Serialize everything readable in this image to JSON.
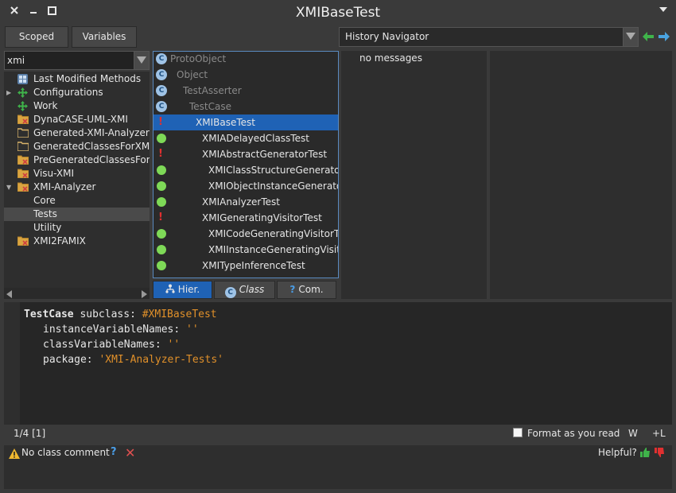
{
  "window": {
    "title": "XMIBaseTest"
  },
  "top_buttons": {
    "scoped": "Scoped",
    "variables": "Variables"
  },
  "filter": {
    "value": "xmi"
  },
  "packages": [
    {
      "label": "Last Modified Methods",
      "icon": "grid-icon",
      "expander": ""
    },
    {
      "label": "Configurations",
      "icon": "configuration-icon",
      "expander": "▶"
    },
    {
      "label": "Work",
      "icon": "configuration-icon",
      "expander": ""
    },
    {
      "label": "DynaCASE-UML-XMI",
      "icon": "package-icon",
      "expander": ""
    },
    {
      "label": "Generated-XMI-Analyzer",
      "icon": "folder-icon",
      "expander": ""
    },
    {
      "label": "GeneratedClassesForXMITe",
      "icon": "folder-icon",
      "expander": ""
    },
    {
      "label": "PreGeneratedClassesForXM",
      "icon": "package-icon",
      "expander": ""
    },
    {
      "label": "Visu-XMI",
      "icon": "package-icon",
      "expander": ""
    },
    {
      "label": "XMI-Analyzer",
      "icon": "package-icon",
      "expander": "▼"
    },
    {
      "label": "Core",
      "icon": "",
      "expander": ""
    },
    {
      "label": "Tests",
      "icon": "",
      "expander": ""
    },
    {
      "label": "Utility",
      "icon": "",
      "expander": ""
    },
    {
      "label": "XMI2FAMIX",
      "icon": "package-icon",
      "expander": ""
    }
  ],
  "classes": [
    {
      "label": "ProtoObject",
      "status": "class",
      "indent": 0
    },
    {
      "label": "Object",
      "status": "class",
      "indent": 1
    },
    {
      "label": "TestAsserter",
      "status": "class",
      "indent": 2
    },
    {
      "label": "TestCase",
      "status": "class",
      "indent": 3
    },
    {
      "label": "XMIBaseTest",
      "status": "error",
      "indent": 4
    },
    {
      "label": "XMIADelayedClassTest",
      "status": "pass",
      "indent": 5
    },
    {
      "label": "XMIAbstractGeneratorTest",
      "status": "error",
      "indent": 5
    },
    {
      "label": "XMIClassStructureGeneratorTe",
      "status": "pass",
      "indent": 6
    },
    {
      "label": "XMIObjectInstanceGeneratorT",
      "status": "pass",
      "indent": 6
    },
    {
      "label": "XMIAnalyzerTest",
      "status": "pass",
      "indent": 5
    },
    {
      "label": "XMIGeneratingVisitorTest",
      "status": "error",
      "indent": 5
    },
    {
      "label": "XMICodeGeneratingVisitorTes",
      "status": "pass",
      "indent": 6
    },
    {
      "label": "XMIInstanceGeneratingVisitor",
      "status": "pass",
      "indent": 6
    },
    {
      "label": "XMITypeInferenceTest",
      "status": "pass",
      "indent": 5
    }
  ],
  "class_tabs": {
    "hier": "Hier.",
    "class": "Class",
    "com": "Com.",
    "class_icon": "C",
    "com_icon": "?"
  },
  "history": {
    "selected": "History Navigator"
  },
  "messages": {
    "text": "no messages"
  },
  "code": {
    "superclass": "TestCase",
    "subclass_kw": " subclass: ",
    "class_symbol": "#XMIBaseTest",
    "ivars_kw": "instanceVariableNames: ",
    "ivars_val": "''",
    "cvars_kw": "classVariableNames: ",
    "cvars_val": "''",
    "package_kw": "package: ",
    "package_val": "'XMI-Analyzer-Tests'"
  },
  "status": {
    "position": "1/4 [1]",
    "format_label": "Format as you read",
    "format_checked": false,
    "w": "W",
    "l": "+L"
  },
  "comment": {
    "text": "No class comment",
    "help": "?",
    "close": "✕",
    "helpful": "Helpful?"
  },
  "colors": {
    "selection": "#1f62b5",
    "pass": "#7ed957",
    "error": "#e03030",
    "symbol": "#e0902a"
  }
}
